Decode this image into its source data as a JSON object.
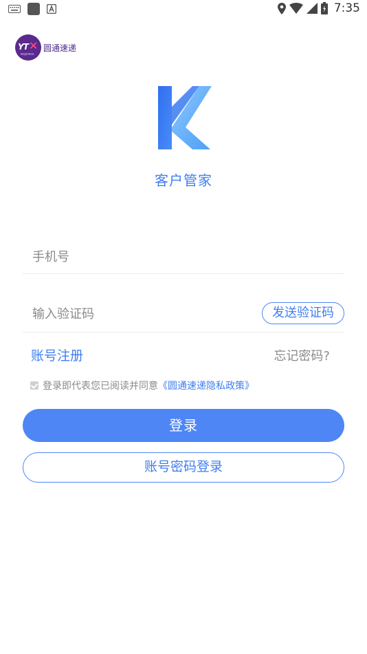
{
  "status_bar": {
    "time": "7:35",
    "icons": [
      "keyboard-icon",
      "app-square-icon",
      "a-box-icon",
      "location-icon",
      "wifi-icon",
      "signal-icon",
      "battery-icon"
    ]
  },
  "brand": {
    "logo_text": "YT",
    "logo_sub": "express",
    "name": "圆通速递"
  },
  "app": {
    "logo_letter": "K",
    "title": "客户管家"
  },
  "form": {
    "phone_placeholder": "手机号",
    "phone_value": "",
    "code_placeholder": "输入验证码",
    "code_value": "",
    "send_code_label": "发送验证码"
  },
  "links": {
    "register": "账号注册",
    "forgot": "忘记密码?"
  },
  "agreement": {
    "checked": true,
    "text": "登录即代表您已阅读并同意",
    "policy_link": "《圆通速递隐私政策》"
  },
  "buttons": {
    "login": "登录",
    "password_login": "账号密码登录"
  },
  "colors": {
    "accent": "#4e86f5",
    "accent_text": "#3f7ef0",
    "brand_purple": "#5a2a8c"
  }
}
